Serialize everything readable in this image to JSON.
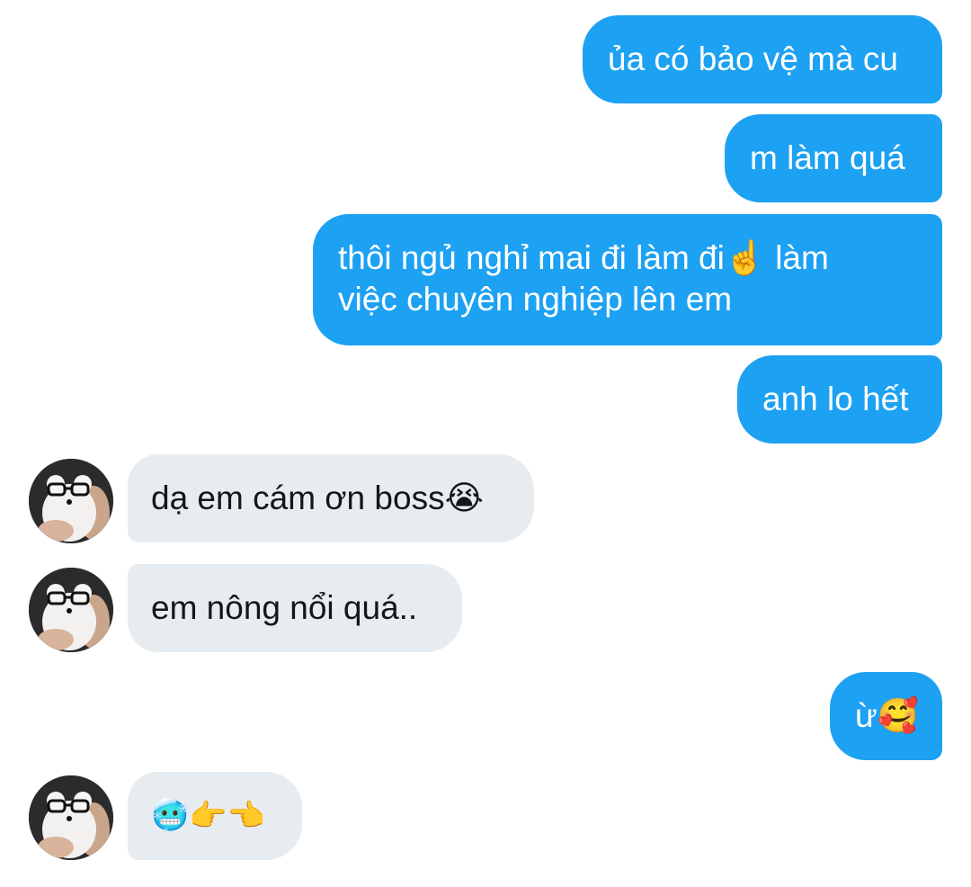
{
  "conversation": {
    "messages": [
      {
        "id": "m1",
        "side": "out",
        "lines": [
          "ủa có bảo vệ mà cu"
        ]
      },
      {
        "id": "m2",
        "side": "out",
        "lines": [
          "m làm quá"
        ]
      },
      {
        "id": "m3",
        "side": "out",
        "lines": [
          "thôi ngủ nghỉ mai đi làm đi☝️ làm",
          "việc chuyên nghiệp lên em"
        ]
      },
      {
        "id": "m4",
        "side": "out",
        "lines": [
          "anh lo hết"
        ]
      },
      {
        "id": "m5",
        "side": "in",
        "lines": [
          "dạ em cám ơn boss😭"
        ]
      },
      {
        "id": "m6",
        "side": "in",
        "lines": [
          "em nông nổi quá.."
        ]
      },
      {
        "id": "m7",
        "side": "out",
        "lines": [
          "ừ🥰"
        ]
      },
      {
        "id": "m8",
        "side": "in",
        "lines": [
          "🥶👉👈"
        ]
      }
    ]
  },
  "colors": {
    "outgoing_bubble": "#1da1f2",
    "incoming_bubble": "#e6ecf0",
    "outgoing_text": "#ffffff",
    "incoming_text": "#14171a"
  },
  "icons": {
    "avatar": "bear-glasses-avatar-icon"
  }
}
